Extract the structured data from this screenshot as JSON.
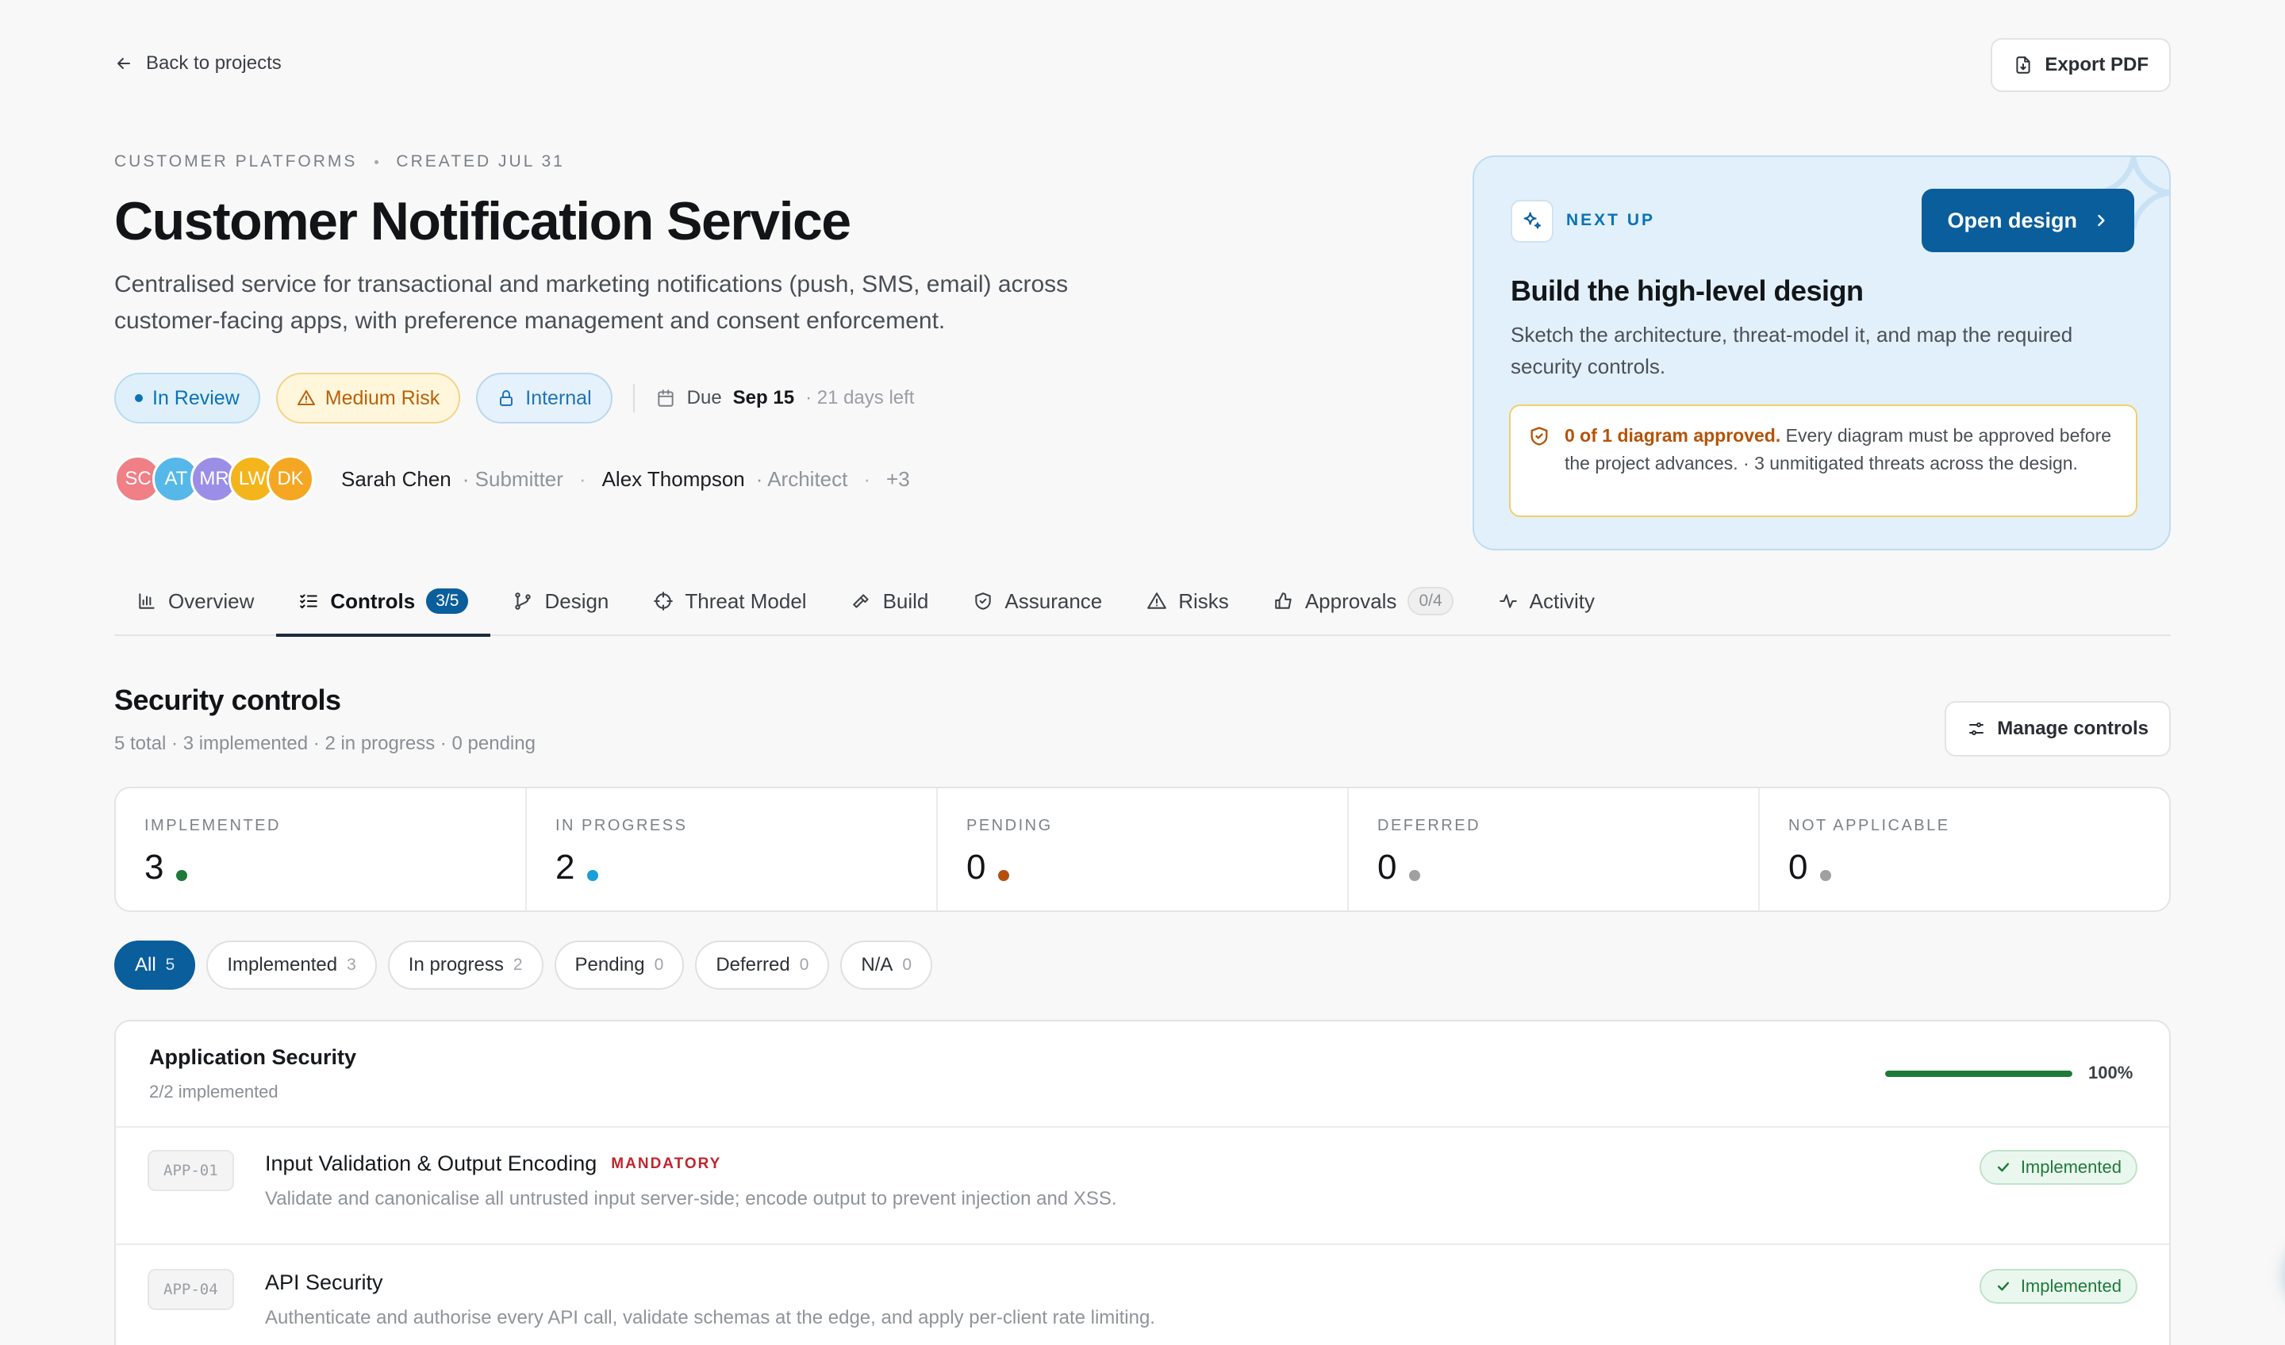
{
  "nav": {
    "back_label": "Back to projects",
    "export_label": "Export PDF"
  },
  "project": {
    "org": "CUSTOMER PLATFORMS",
    "created": "CREATED JUL 31",
    "title": "Customer Notification Service",
    "description": "Centralised service for transactional and marketing notifications (push, SMS, email) across customer-facing apps, with preference management and consent enforcement.",
    "status": "In Review",
    "risk": "Medium Risk",
    "visibility": "Internal",
    "due_label": "Due",
    "due_date": "Sep 15",
    "days_left": "· 21 days left"
  },
  "team": {
    "avatars": [
      {
        "initials": "SC",
        "color": "#f07f86"
      },
      {
        "initials": "AT",
        "color": "#55b8e8"
      },
      {
        "initials": "MR",
        "color": "#9b8ee6"
      },
      {
        "initials": "LW",
        "color": "#f3b51b"
      },
      {
        "initials": "DK",
        "color": "#f5a623"
      }
    ],
    "submitter_name": "Sarah Chen",
    "submitter_role": "· Submitter",
    "architect_name": "Alex Thompson",
    "architect_role": "· Architect",
    "extra": "+3"
  },
  "next_up": {
    "label": "NEXT UP",
    "button": "Open design",
    "title": "Build the high-level design",
    "subtitle": "Sketch the architecture, threat-model it, and map the required security controls.",
    "warn_bold": "0 of 1 diagram approved.",
    "warn_text": " Every diagram must be approved before the project advances. · 3 unmitigated threats across the design."
  },
  "tabs": [
    {
      "label": "Overview",
      "icon": "chart-icon"
    },
    {
      "label": "Controls",
      "count": "3/5",
      "icon": "checklist-icon"
    },
    {
      "label": "Design",
      "icon": "branch-icon"
    },
    {
      "label": "Threat Model",
      "icon": "crosshair-icon"
    },
    {
      "label": "Build",
      "icon": "hammer-icon"
    },
    {
      "label": "Assurance",
      "icon": "shield-check-icon"
    },
    {
      "label": "Risks",
      "icon": "warning-icon"
    },
    {
      "label": "Approvals",
      "count": "0/4",
      "icon": "thumbs-up-icon"
    },
    {
      "label": "Activity",
      "icon": "pulse-icon"
    }
  ],
  "controls": {
    "title": "Security controls",
    "summary": "5 total · 3 implemented · 2 in progress · 0 pending",
    "manage_label": "Manage controls",
    "stats": [
      {
        "label": "IMPLEMENTED",
        "value": "3",
        "color": "#1f7a3a"
      },
      {
        "label": "IN PROGRESS",
        "value": "2",
        "color": "#1a9fd8"
      },
      {
        "label": "PENDING",
        "value": "0",
        "color": "#b4500f"
      },
      {
        "label": "DEFERRED",
        "value": "0",
        "color": "#a0a0a0"
      },
      {
        "label": "NOT APPLICABLE",
        "value": "0",
        "color": "#a0a0a0"
      }
    ],
    "filters": [
      {
        "label": "All",
        "count": "5"
      },
      {
        "label": "Implemented",
        "count": "3"
      },
      {
        "label": "In progress",
        "count": "2"
      },
      {
        "label": "Pending",
        "count": "0"
      },
      {
        "label": "Deferred",
        "count": "0"
      },
      {
        "label": "N/A",
        "count": "0"
      }
    ],
    "group": {
      "title": "Application Security",
      "subtitle": "2/2 implemented",
      "progress": 100,
      "progress_label": "100%",
      "items": [
        {
          "code": "APP-01",
          "title": "Input Validation & Output Encoding",
          "tag": "MANDATORY",
          "description": "Validate and canonicalise all untrusted input server-side; encode output to prevent injection and XSS.",
          "status": "Implemented"
        },
        {
          "code": "APP-04",
          "title": "API Security",
          "tag": "",
          "description": "Authenticate and authorise every API call, validate schemas at the edge, and apply per-client rate limiting.",
          "status": "Implemented"
        }
      ]
    }
  }
}
